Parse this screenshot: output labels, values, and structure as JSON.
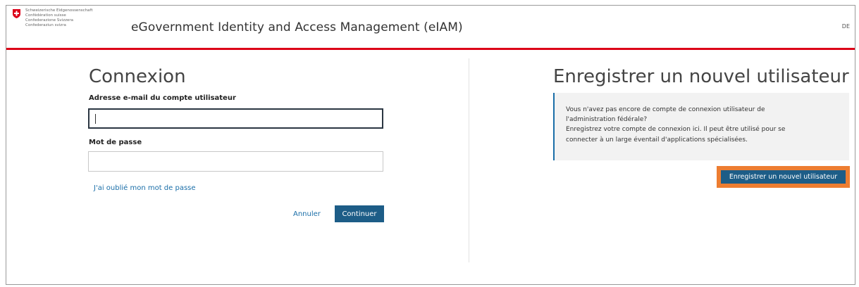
{
  "header": {
    "confederation_lines": [
      "Schweizerische Eidgenossenschaft",
      "Confédération suisse",
      "Confederazione Svizzera",
      "Confederaziun svizra"
    ],
    "app_title": "eGovernment Identity and Access Management (eIAM)",
    "language": "DE"
  },
  "login": {
    "title": "Connexion",
    "email_label": "Adresse e-mail du compte utilisateur",
    "email_value": "",
    "password_label": "Mot de passe",
    "password_value": "",
    "forgot_link": "J'ai oublié mon mot de passe",
    "cancel_label": "Annuler",
    "continue_label": "Continuer"
  },
  "register": {
    "title": "Enregistrer un nouvel utilisateur",
    "info_lines": [
      "Vous n'avez pas encore de compte de connexion utilisateur de",
      "l'administration fédérale?",
      "Enregistrez votre compte de connexion ici. Il peut être utilisé pour se",
      "connecter à un large éventail d'applications spécialisées."
    ],
    "button_label": "Enregistrer un nouvel utilisateur"
  },
  "colors": {
    "swiss_red": "#dc0018",
    "primary_blue": "#1d5d87",
    "link_blue": "#1a6ea8",
    "highlight_orange": "#ed7d31"
  }
}
